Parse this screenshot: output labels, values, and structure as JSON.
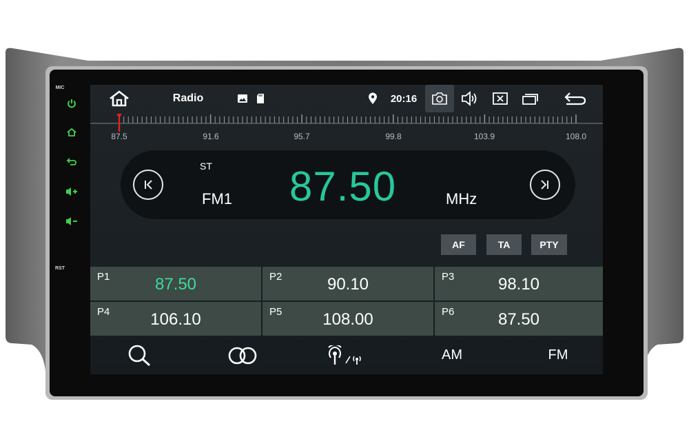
{
  "status_bar": {
    "title": "Radio",
    "clock": "20:16"
  },
  "side_panel": {
    "mic_label": "MIC",
    "rst_label": "RST"
  },
  "tuner": {
    "scale_labels": [
      "87.5",
      "91.6",
      "95.7",
      "99.8",
      "103.9",
      "108.0"
    ],
    "stereo": "ST",
    "band": "FM1",
    "frequency": "87.50",
    "unit": "MHz"
  },
  "options": {
    "af_label": "AF",
    "ta_label": "TA",
    "pty_label": "PTY"
  },
  "presets": [
    {
      "label": "P1",
      "freq": "87.50",
      "active": true
    },
    {
      "label": "P2",
      "freq": "90.10",
      "active": false
    },
    {
      "label": "P3",
      "freq": "98.10",
      "active": false
    },
    {
      "label": "P4",
      "freq": "106.10",
      "active": false
    },
    {
      "label": "P5",
      "freq": "108.00",
      "active": false
    },
    {
      "label": "P6",
      "freq": "87.50",
      "active": false
    }
  ],
  "bottom_bar": {
    "am_label": "AM",
    "fm_label": "FM"
  },
  "colors": {
    "accent_green": "#27c79a",
    "side_icon_green": "#3fd24a",
    "needle_red": "#e0241c",
    "preset_bg": "#3d4a46"
  },
  "icons": [
    "home-icon",
    "image-icon",
    "sd-card-icon",
    "location-icon",
    "camera-icon",
    "volume-icon",
    "close-box-icon",
    "windows-icon",
    "back-icon",
    "prev-icon",
    "next-icon",
    "search-icon",
    "stereo-icon",
    "signal-icon",
    "power-icon",
    "side-home-icon",
    "side-back-icon",
    "volume-up-icon",
    "volume-down-icon"
  ]
}
